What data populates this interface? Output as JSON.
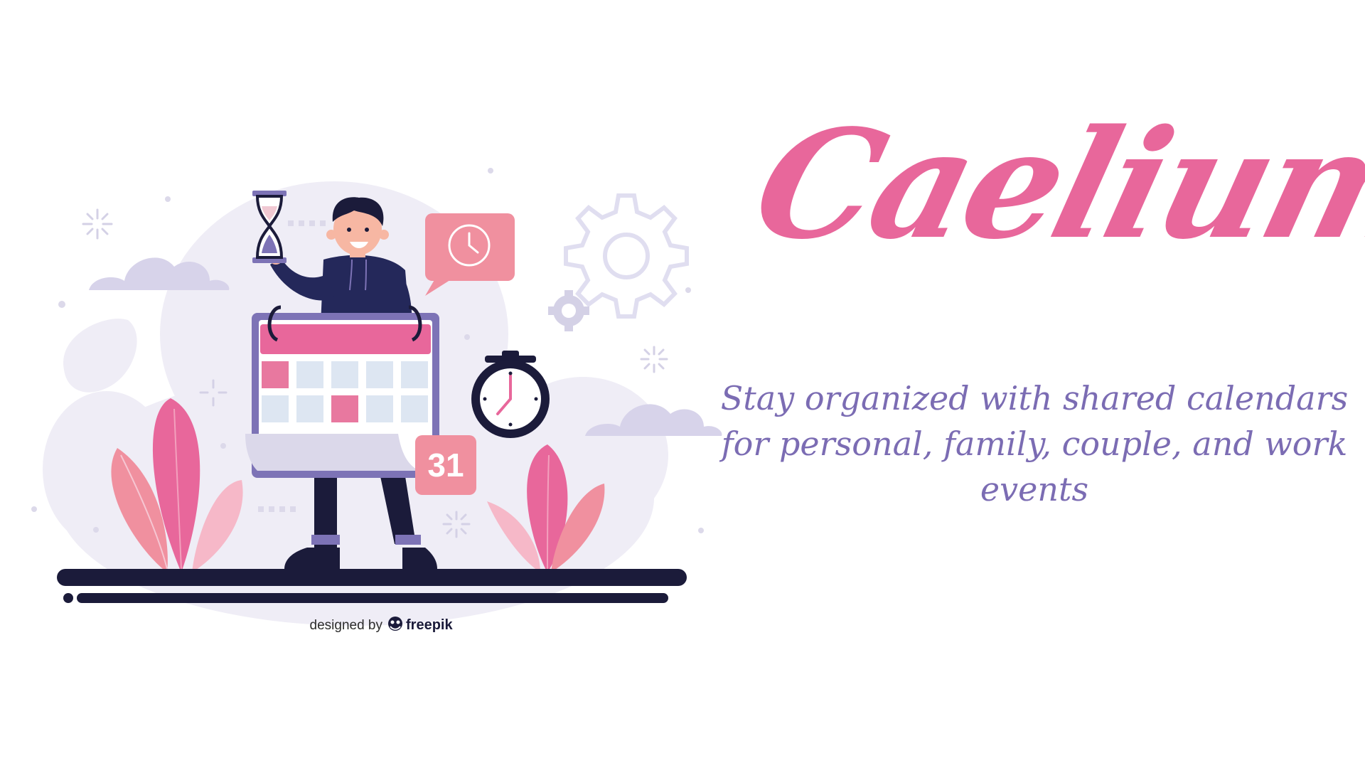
{
  "brand": {
    "title": "Caelium",
    "tagline": "Stay organized with shared calendars for personal, family, couple, and work events",
    "colors": {
      "title_pink": "#e8679b",
      "tagline_purple": "#7b6cb3",
      "navy": "#1b1b3a",
      "blob_lavender": "#efedf6",
      "calendar_frame": "#7d73b6",
      "calendar_cell": "#dde6f2"
    }
  },
  "illustration": {
    "calendar_day_badge": "31",
    "credit_prefix": "designed by",
    "credit_brand": "freepik",
    "icons": [
      "hourglass-icon",
      "clock-speech-bubble-icon",
      "gear-icon",
      "stopwatch-icon",
      "calendar-icon",
      "cloud-icon",
      "sparkle-icon",
      "plant-leaf-icon",
      "freepik-logo-icon"
    ]
  }
}
